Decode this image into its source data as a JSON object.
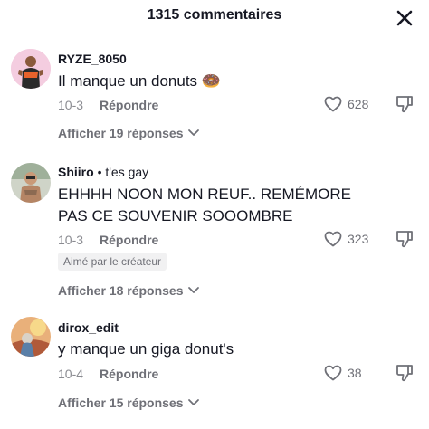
{
  "header": {
    "title": "1315 commentaires"
  },
  "comments": [
    {
      "username": "RYZE_8050",
      "text": "Il manque un donuts 🍩",
      "date": "10-3",
      "reply_label": "Répondre",
      "likes": "628",
      "view_replies": "Afficher 19 réponses"
    },
    {
      "username": "Shiiro",
      "tag": "• t'es gay",
      "text": "EHHHH NOON MON REUF.. REMÉMORE PAS CE SOUVENIR SOOOMBRE",
      "date": "10-3",
      "reply_label": "Répondre",
      "likes": "323",
      "badge": "Aimé par le créateur",
      "view_replies": "Afficher 18 réponses"
    },
    {
      "username": "dirox_edit",
      "text": "y manque un giga donut's",
      "date": "10-4",
      "reply_label": "Répondre",
      "likes": "38",
      "view_replies": "Afficher 15 réponses"
    }
  ],
  "icons": {
    "close": "close-icon",
    "like": "heart-outline-icon",
    "dislike": "thumbs-down-icon",
    "expand": "chevron-down-icon"
  }
}
